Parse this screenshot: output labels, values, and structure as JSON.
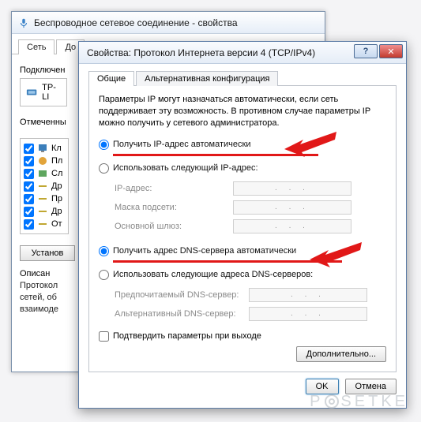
{
  "back_window": {
    "title": "Беспроводное сетевое соединение - свойства",
    "tabs": [
      "Сеть",
      "До"
    ],
    "connect_label": "Подключен",
    "adapter": "TP-LI",
    "checked_header": "Отмеченны",
    "items": [
      "Кл",
      "Пл",
      "Сл",
      "Др",
      "Пр",
      "Др",
      "От"
    ],
    "install_btn": "Установ",
    "desc_header": "Описан",
    "desc_body": "Протокол\nсетей, об\nвзаимоде"
  },
  "front_window": {
    "title": "Свойства: Протокол Интернета версии 4 (TCP/IPv4)",
    "tabs": {
      "general": "Общие",
      "alt": "Альтернативная конфигурация"
    },
    "intro": "Параметры IP могут назначаться автоматически, если сеть поддерживает эту возможность. В противном случае параметры IP можно получить у сетевого администратора.",
    "ip": {
      "auto_label": "Получить IP-адрес автоматически",
      "manual_label": "Использовать следующий IP-адрес:",
      "fields": {
        "ip": "IP-адрес:",
        "mask": "Маска подсети:",
        "gw": "Основной шлюз:"
      }
    },
    "dns": {
      "auto_label": "Получить адрес DNS-сервера автоматически",
      "manual_label": "Использовать следующие адреса DNS-серверов:",
      "fields": {
        "pref": "Предпочитаемый DNS-сервер:",
        "alt": "Альтернативный DNS-сервер:"
      }
    },
    "confirm_label": "Подтвердить параметры при выходе",
    "advanced_btn": "Дополнительно...",
    "ok_btn": "OK",
    "cancel_btn": "Отмена",
    "help_glyph": "?",
    "close_glyph": "✕"
  },
  "watermark": "P  SETKE"
}
